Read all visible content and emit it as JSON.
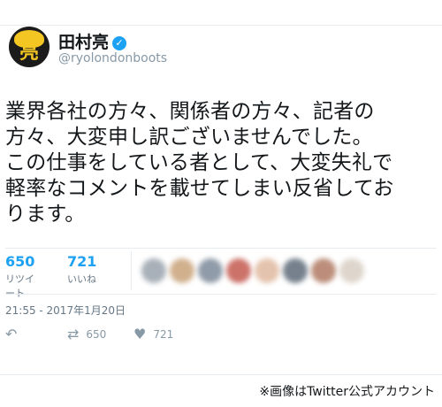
{
  "user": {
    "display_name": "田村亮",
    "handle": "@ryolondonboots",
    "avatar_text": "亮",
    "verified_glyph": "✓"
  },
  "tweet": {
    "lines": [
      "業界各社の方々、関係者の方々、記者の",
      "方々、大変申し訳ございませんでした。",
      "この仕事をしている者として、大変失礼で",
      "軽率なコメントを載せてしまい反省してお",
      "ります。"
    ],
    "timestamp": "21:55 - 2017年1月20日"
  },
  "stats": {
    "retweets": {
      "count": "650",
      "label": "リツイート"
    },
    "likes": {
      "count": "721",
      "label": "いいね"
    }
  },
  "actions": {
    "reply_icon": "↶",
    "retweet_icon": "⇄",
    "retweet_count": "650",
    "like_icon": "♥",
    "like_count": "721"
  },
  "caption": "※画像はTwitter公式アカウント",
  "colors": {
    "accent": "#1da1f2",
    "text": "#14171a",
    "muted": "#657786",
    "avatar_bg": "#1b1b1b",
    "avatar_accent": "#f3c623"
  },
  "blurred_faces": [
    "#9aa3ad",
    "#c9a37a",
    "#7c8a9a",
    "#c45a4f",
    "#e0b9a0",
    "#5d6b79",
    "#b07a63",
    "#d9cfc4"
  ]
}
